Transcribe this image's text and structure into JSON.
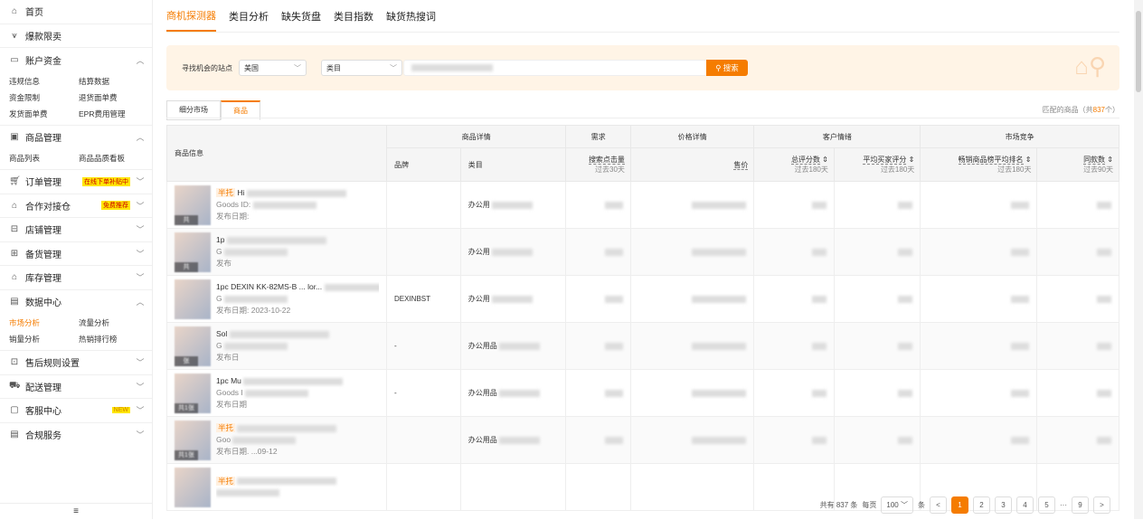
{
  "sidebar": {
    "home": "首页",
    "hot": "爆款限卖",
    "account": {
      "label": "账户资金",
      "items": [
        "违规信息",
        "结算数据",
        "资金限制",
        "退货面单费",
        "发货面单费",
        "EPR费用管理"
      ]
    },
    "goods": {
      "label": "商品管理",
      "items": [
        "商品列表",
        "商品品质看板"
      ]
    },
    "orders": {
      "label": "订单管理",
      "badge": "在线下单补贴中"
    },
    "coop": {
      "label": "合作对接仓",
      "badge": "免费推荐"
    },
    "store": "店铺管理",
    "stock": "备货管理",
    "inventory": "库存管理",
    "data": {
      "label": "数据中心",
      "items": [
        "市场分析",
        "流量分析",
        "销量分析",
        "热销排行榜"
      ]
    },
    "aftersale": "售后规则设置",
    "delivery": "配送管理",
    "service": {
      "label": "客服中心",
      "badge": "NEW"
    },
    "compliance": "合规服务"
  },
  "tabs": [
    "商机探测器",
    "类目分析",
    "缺失货盘",
    "类目指数",
    "缺货热搜词"
  ],
  "search": {
    "site_label": "寻找机会的站点",
    "site_value": "美国",
    "category_placeholder": "类目",
    "button": "搜索"
  },
  "subtabs": [
    "细分市场",
    "商品"
  ],
  "matched": {
    "prefix": "匹配的商品（共",
    "count": "837",
    "suffix": "个）"
  },
  "table": {
    "groups": [
      "商品信息",
      "商品详情",
      "需求",
      "价格详情",
      "客户情绪",
      "市场竞争"
    ],
    "cols": {
      "brand": "品牌",
      "category": "类目",
      "clicks": "搜索点击量",
      "clicks_sub": "过去30天",
      "price": "售价",
      "score": "总评分数",
      "score_sub": "过去180天",
      "rating": "平均买家评分",
      "rating_sub": "过去180天",
      "rank": "畅销商品榜平均排名",
      "rank_sub": "过去180天",
      "same": "同款数",
      "same_sub": "过去90天"
    },
    "rows": [
      {
        "tag": "半托",
        "title": "Hi",
        "id": "Goods ID:",
        "date": "发布日期:",
        "brand": "",
        "category": "办公用",
        "count": "共"
      },
      {
        "tag": "",
        "title": "1p",
        "id": "G",
        "date": "发布",
        "brand": "",
        "category": "办公用",
        "count": "共"
      },
      {
        "tag": "",
        "title": "1pc DEXIN KK-82MS-B ... lor...",
        "id": "G",
        "date": "发布日期:  2023-10-22",
        "brand": "DEXINBST",
        "category": "办公用",
        "count": ""
      },
      {
        "tag": "",
        "title": "Sol",
        "id": "G",
        "date": "发布日",
        "brand": "-",
        "category": "办公用品",
        "count": "张"
      },
      {
        "tag": "",
        "title": "1pc Mu",
        "id": "Goods I",
        "date": "发布日期",
        "brand": "-",
        "category": "办公用品",
        "count": "共1张"
      },
      {
        "tag": "半托",
        "title": "",
        "id": "Goo",
        "date": "发布日期.  ...09-12",
        "brand": "",
        "category": "办公用品",
        "count": "共1张"
      },
      {
        "tag": "半托",
        "title": "",
        "id": "",
        "date": "",
        "brand": "",
        "category": "",
        "count": ""
      }
    ]
  },
  "pager": {
    "total": "共有 837 条",
    "per_label": "每页",
    "per_value": "100",
    "unit": "条",
    "pages": [
      "1",
      "2",
      "3",
      "4",
      "5",
      "9"
    ],
    "ellipsis": "···",
    "prev": "<",
    "next": ">"
  }
}
